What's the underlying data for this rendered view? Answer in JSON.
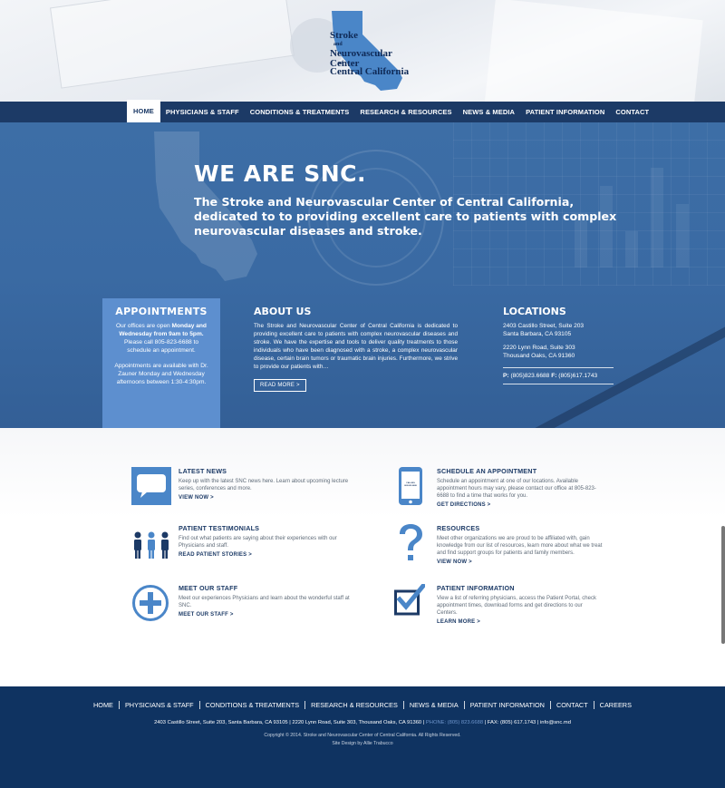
{
  "logo": {
    "line1": "Stroke",
    "line2": "and",
    "line3": "Neurovascular Center",
    "line4": "of",
    "line5": "Central California"
  },
  "nav": {
    "items": [
      "HOME",
      "PHYSICIANS & STAFF",
      "CONDITIONS & TREATMENTS",
      "RESEARCH & RESOURCES",
      "NEWS & MEDIA",
      "PATIENT INFORMATION",
      "CONTACT"
    ],
    "active": "HOME"
  },
  "hero": {
    "title": "WE ARE SNC.",
    "subtitle": "The Stroke and Neurovascular Center of Central California, dedicated to to providing excellent care to patients with complex neurovascular diseases and stroke."
  },
  "appointments": {
    "title": "APPOINTMENTS",
    "text_pre": "Our offices are open ",
    "text_bold": "Monday and Wednesday from 9am to 5pm.",
    "text_post": " Please call 805-823-6688 to schedule an appointment.",
    "text2": "Appointments are available with Dr. Zauner Monday and Wednesday afternoons between 1:30-4:30pm."
  },
  "about": {
    "title": "ABOUT US",
    "text": "The Stroke and Neurovascular Center of Central California is dedicated to providing excellent care to patients with complex neurovascular diseases and stroke. We have the expertise and tools to deliver quality treatments to those individuals who have been diagnosed with a stroke, a complex neurovascular disease, certain brain tumors or traumatic brain injuries. Furthermore, we strive to provide our patients with…",
    "button": "READ MORE >"
  },
  "locations": {
    "title": "LOCATIONS",
    "addr1_line1": "2403 Castillo Street, Suite 203",
    "addr1_line2": "Santa Barbara, CA 93105",
    "addr2_line1": "2220 Lynn Road, Suite 303",
    "addr2_line2": "Thousand Oaks, CA 91360",
    "phone_label": "P:",
    "phone": "(805)823.6688",
    "fax_label": "F:",
    "fax": "(805)617.1743"
  },
  "features": {
    "news": {
      "icon": "speech-bubble-icon",
      "title": "LATEST NEWS",
      "text": "Keep up with the latest SNC news here. Learn about upcoming lecture series, conferences and more.",
      "link": "VIEW NOW >"
    },
    "testimonials": {
      "icon": "people-icon",
      "title": "PATIENT TESTIMONIALS",
      "text": "Find out what patients are saying about their experiences with our Physicians and staff.",
      "link": "READ PATIENT STORIES >"
    },
    "staff": {
      "icon": "plus-circle-icon",
      "title": "MEET OUR STAFF",
      "text": "Meet our experiences Physicians and learn about the wonderful staff at SNC.",
      "link": "MEET OUR STAFF >"
    },
    "schedule": {
      "icon": "phone-icon",
      "phone_screen": "CALLING 805.823.6688",
      "title": "SCHEDULE AN APPOINTMENT",
      "text": "Schedule an appointment at one of our locations. Available appointment hours may vary, please contact our office at 805-823-6688 to find a time that works for you.",
      "link": "GET DIRECTIONS >"
    },
    "resources": {
      "icon": "question-mark-icon",
      "title": "RESOURCES",
      "text": "Meet other organizations we are proud to be affiliated with, gain knowledge from our list of resources, learn more about what we treat and find support groups for patients and family members.",
      "link": "VIEW NOW >"
    },
    "patient_info": {
      "icon": "checkbox-icon",
      "title": "PATIENT INFORMATION",
      "text": "View a list of referring physicians, access the Patient Portal, check appointment times, download forms and get directions to our Centers.",
      "link": "LEARN MORE >"
    }
  },
  "footer": {
    "nav": [
      "HOME",
      "PHYSICIANS & STAFF",
      "CONDITIONS & TREATMENTS",
      "RESEARCH & RESOURCES",
      "NEWS & MEDIA",
      "PATIENT INFORMATION",
      "CONTACT",
      "CAREERS"
    ],
    "address_pre": "2403 Castillo Street, Suite 203, Santa Barbara, CA 93105 | 2220 Lynn Road, Suite 303, Thousand Oaks, CA 91360 | ",
    "phone": "PHONE: (805) 823.6688",
    "address_post": " | FAX: (805) 617.1743 | info@snc.md",
    "copyright": "Copyright © 2014. Stroke and Neurovascular Center of Central California. All Rights Reserved.",
    "credit": "Site Design by Allie Trabucco"
  },
  "colors": {
    "nav_bg": "#1c3a66",
    "hero_bg": "#3d6ea6",
    "accent": "#4a86c8",
    "footer_bg": "#0f3361"
  }
}
